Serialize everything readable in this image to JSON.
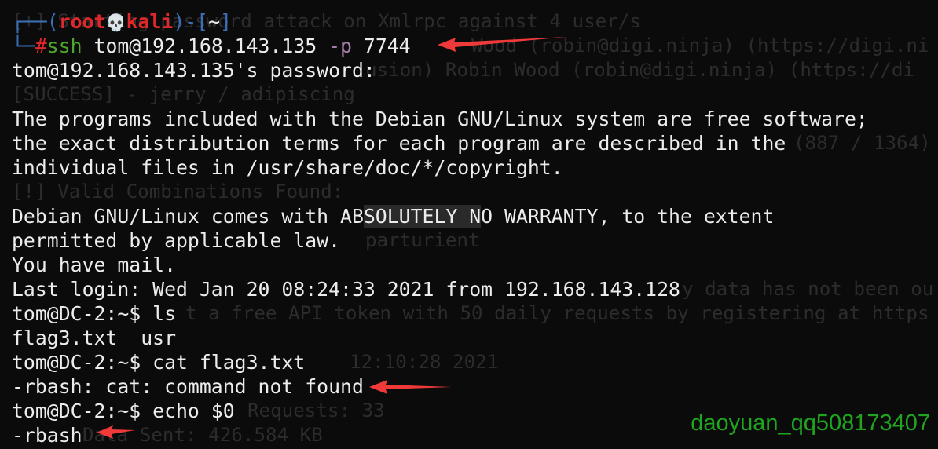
{
  "ghost_lines": [
    "[+] Starting password attack on Xmlrpc against 4 user/s",
    "Wood (robin@digi.ninja) (https://digi.ni",
    "usion) Robin Wood (robin@digi.ninja) (https://di",
    "[SUCCESS] - jerry / adipiscing",
    "(887 / 1364)",
    "[!] Valid Combinations Found:",
    "parturient",
    "y data has not been ou",
    "t a free API token with 50 daily requests by registering at https",
    "12:10:28 2021",
    "Requests: 33",
    "Data Sent: 426.584 KB"
  ],
  "prompt": {
    "box_top": "┌──(",
    "user": "root",
    "skull": "💀",
    "host": "kali",
    "mid": ")-[",
    "cwd": "~",
    "end": "]",
    "box_bottom": "└─",
    "hash": "#",
    "cmd": "ssh",
    "args": " tom@192.168.143.135 ",
    "flag": "-p",
    "port": " 7744"
  },
  "output": {
    "l3": "tom@192.168.143.135's password:",
    "l5": "The programs included with the Debian GNU/Linux system are free software;",
    "l6": "the exact distribution terms for each program are described in the",
    "l7": "individual files in /usr/share/doc/*/copyright.",
    "l9a": "Debian GNU/Linux comes with AB",
    "l9b": "SOLUTELY N",
    "l9c": "O WARRANTY, to the extent",
    "l10": "permitted by applicable law.",
    "l11": "You have mail.",
    "l12": "Last login: Wed Jan 20 08:24:33 2021 from 192.168.143.128",
    "l13": "tom@DC-2:~$ ls",
    "l14": "flag3.txt  usr",
    "l15": "tom@DC-2:~$ cat flag3.txt",
    "l16": "-rbash: cat: command not found",
    "l17": "tom@DC-2:~$ echo $0",
    "l18": "-rbash"
  },
  "watermark": "daoyuan_qq508173407",
  "colors": {
    "arrow": "#f03a3a",
    "watermark": "#1fa51f",
    "background": "#0b0b0b"
  }
}
